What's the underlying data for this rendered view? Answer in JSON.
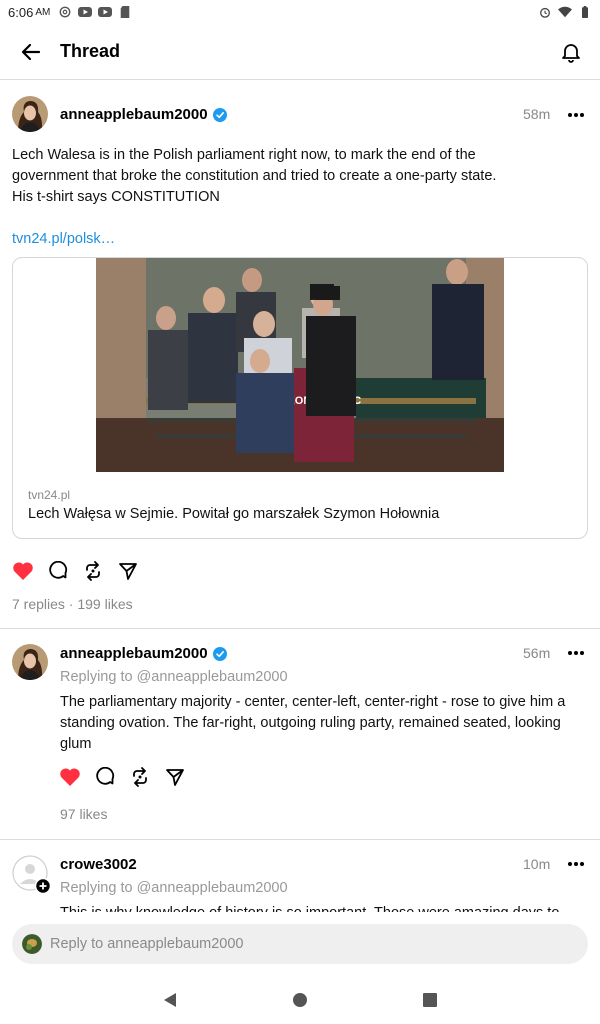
{
  "status_bar": {
    "time": "6:06",
    "ampm": "AM",
    "left_icons": [
      "threads-icon",
      "youtube-icon",
      "youtube-icon",
      "sd-card-icon"
    ],
    "right_icons": [
      "alarm-icon",
      "wifi-icon",
      "battery-icon"
    ]
  },
  "header": {
    "title": "Thread"
  },
  "main_post": {
    "username": "anneapplebaum2000",
    "verified": true,
    "time": "58m",
    "text_line1": "Lech Walesa is in the Polish parliament right now, to mark the end of the",
    "text_line2": "government that broke the constitution and tried to create a one-party state.",
    "text_line3": "His t-shirt says CONSTITUTION",
    "link": "tvn24.pl/polsk…",
    "card": {
      "domain": "tvn24.pl",
      "headline": "Lech Wałęsa w Sejmie. Powitał go marszałek Szymon Hołownia",
      "tshirt_text": "KON STY TUC"
    },
    "liked": true,
    "stats": "7 replies · 199 likes"
  },
  "reply1": {
    "username": "anneapplebaum2000",
    "verified": true,
    "time": "56m",
    "replying_to": "Replying to @anneapplebaum2000",
    "text_line1": "The parliamentary majority - center, center-left, center-right - rose to give him a",
    "text_line2": "standing ovation. The far-right, outgoing ruling party, remained seated, looking",
    "text_line3": "glum",
    "liked": true,
    "stats": "97 likes"
  },
  "reply2": {
    "username": "crowe3002",
    "verified": false,
    "time": "10m",
    "replying_to": "Replying to @anneapplebaum2000",
    "text_partial": "This is why knowledge of history is so important. Those were amazing days to"
  },
  "reply_bar": {
    "placeholder": "Reply to anneapplebaum2000"
  },
  "colors": {
    "accent_link": "#1d8fde",
    "verified": "#1d9bf0",
    "like": "#ff3040",
    "muted": "#888888"
  }
}
